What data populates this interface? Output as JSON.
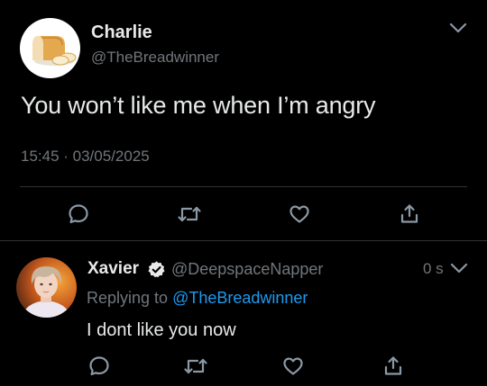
{
  "main_tweet": {
    "avatar_icon": "bread-loaf-icon",
    "author_name": "Charlie",
    "author_handle": "@TheBreadwinner",
    "text": "You won’t like me when I’m angry",
    "timestamp": "15:45 · 03/05/2025",
    "actions": [
      "reply-icon",
      "retweet-icon",
      "like-icon",
      "share-icon"
    ]
  },
  "reply": {
    "author_name": "Xavier",
    "verified": true,
    "author_handle": "@DeepspaceNapper",
    "time_ago": "0 s",
    "replying_prefix": "Replying to ",
    "replying_handle": "@TheBreadwinner",
    "text": "I dont like you now",
    "actions": [
      "reply-icon",
      "retweet-icon",
      "like-icon",
      "share-icon"
    ]
  },
  "colors": {
    "background": "#000000",
    "text": "#e7e9ea",
    "secondary": "#71767b",
    "link": "#1d9bf0",
    "divider": "#2f3336"
  }
}
